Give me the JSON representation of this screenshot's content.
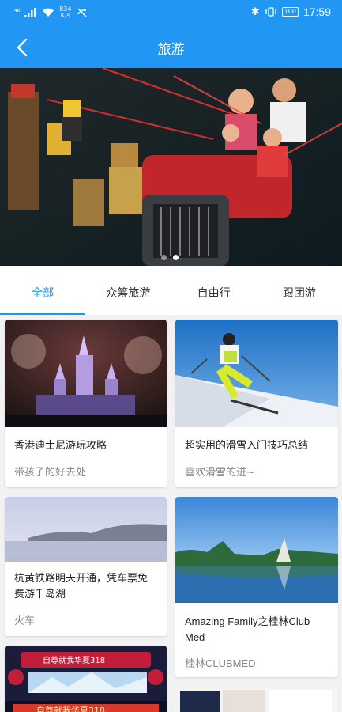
{
  "status": {
    "network": "⁴⁶",
    "speed_value": "834",
    "speed_unit": "K/s",
    "battery": "100",
    "time": "17:59"
  },
  "header": {
    "title": "旅游"
  },
  "banner": {
    "slide_count": 2,
    "active_slide": 2
  },
  "tabs": [
    {
      "label": "全部",
      "active": true
    },
    {
      "label": "众筹旅游",
      "active": false
    },
    {
      "label": "自由行",
      "active": false
    },
    {
      "label": "跟团游",
      "active": false
    }
  ],
  "cards": [
    {
      "title": "香港迪士尼游玩攻略",
      "subtitle": "带孩子的好去处"
    },
    {
      "title": "超实用的滑雪入门技巧总结",
      "subtitle": "喜欢滑雪的进~"
    },
    {
      "title": "杭黄铁路明天开通，凭车票免费游千岛湖",
      "subtitle": "火车"
    },
    {
      "title": "Amazing Family之桂林Club Med",
      "subtitle": "桂林CLUBMED"
    }
  ],
  "poster": {
    "brand": "自尊就我华夏318",
    "sub": "自尊就我华夏318"
  }
}
